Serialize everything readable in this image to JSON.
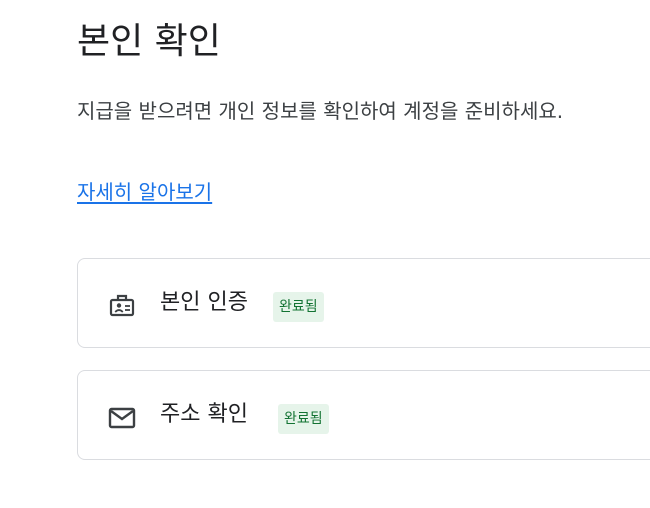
{
  "header": {
    "title": "본인 확인",
    "description": "지급을 받으려면 개인 정보를 확인하여 계정을 준비하세요.",
    "learn_more_link": "자세히 알아보기"
  },
  "cards": [
    {
      "label": "본인 인증",
      "status": "완료됨",
      "icon": "id-badge-icon"
    },
    {
      "label": "주소 확인",
      "status": "완료됨",
      "icon": "mail-icon"
    }
  ],
  "colors": {
    "link": "#1a73e8",
    "badge_bg": "#e6f4ea",
    "badge_text": "#137333",
    "card_border": "#dadce0"
  }
}
